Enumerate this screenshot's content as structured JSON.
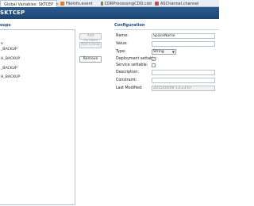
{
  "tabs": [
    {
      "label": "Global Variables: SKTCEP",
      "active": true
    },
    {
      "label": "FileInfo.event",
      "active": false
    },
    {
      "label": "CDRProcessingCDD.cdd",
      "active": false
    },
    {
      "label": "ASChannel.channel",
      "active": false
    }
  ],
  "editor_title": "SKTCEP",
  "groups": {
    "header": "oups",
    "items": [
      "e",
      "_BACKUP",
      "H_BACKUP",
      "_BACKUP",
      "H_BACKUP"
    ],
    "buttons": {
      "add_variable": "Add Variable",
      "add_group": "Add Group",
      "remove": "Remove"
    }
  },
  "configuration": {
    "header": "Configuration",
    "name_label": "Name:",
    "name_value": "SpaceName",
    "value_label": "Value:",
    "value_value": "",
    "type_label": "Type:",
    "type_value": "String",
    "deployment_label": "Deployment settable:",
    "deployment_checked": true,
    "service_label": "Service settable:",
    "service_checked": false,
    "description_label": "Description:",
    "description_value": "",
    "constraint_label": "Constraint:",
    "constraint_value": "",
    "last_modified_label": "Last Modified:",
    "last_modified_value": "2015/04/09 13:23:07"
  },
  "colors": {
    "title_bar": "#1d4670",
    "section_header": "#1f4c7e"
  }
}
